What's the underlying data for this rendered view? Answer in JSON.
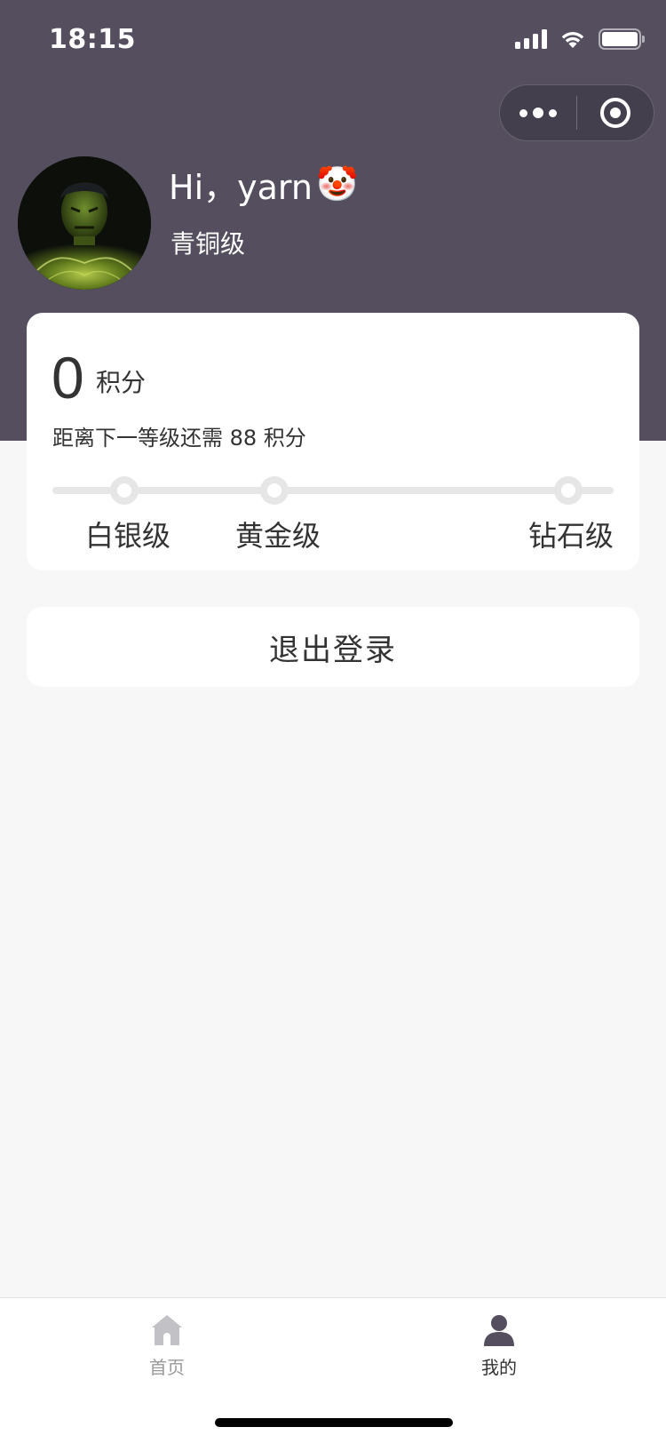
{
  "status_bar": {
    "time": "18:15"
  },
  "profile": {
    "greeting": "Hi，yarn",
    "greeting_emoji": "🤡",
    "level": "青铜级"
  },
  "points": {
    "value": "0",
    "unit": "积分",
    "next_level_tip": "距离下一等级还需 88 积分",
    "tiers": [
      "白银级",
      "黄金级",
      "钻石级"
    ]
  },
  "logout_label": "退出登录",
  "tabbar": {
    "items": [
      {
        "label": "首页",
        "icon": "home-icon",
        "active": false
      },
      {
        "label": "我的",
        "icon": "user-icon",
        "active": true
      }
    ]
  },
  "colors": {
    "header_bg": "#544e5e",
    "page_bg": "#f7f7f7",
    "tab_inactive": "#999999",
    "tab_active": "#544e5e"
  }
}
